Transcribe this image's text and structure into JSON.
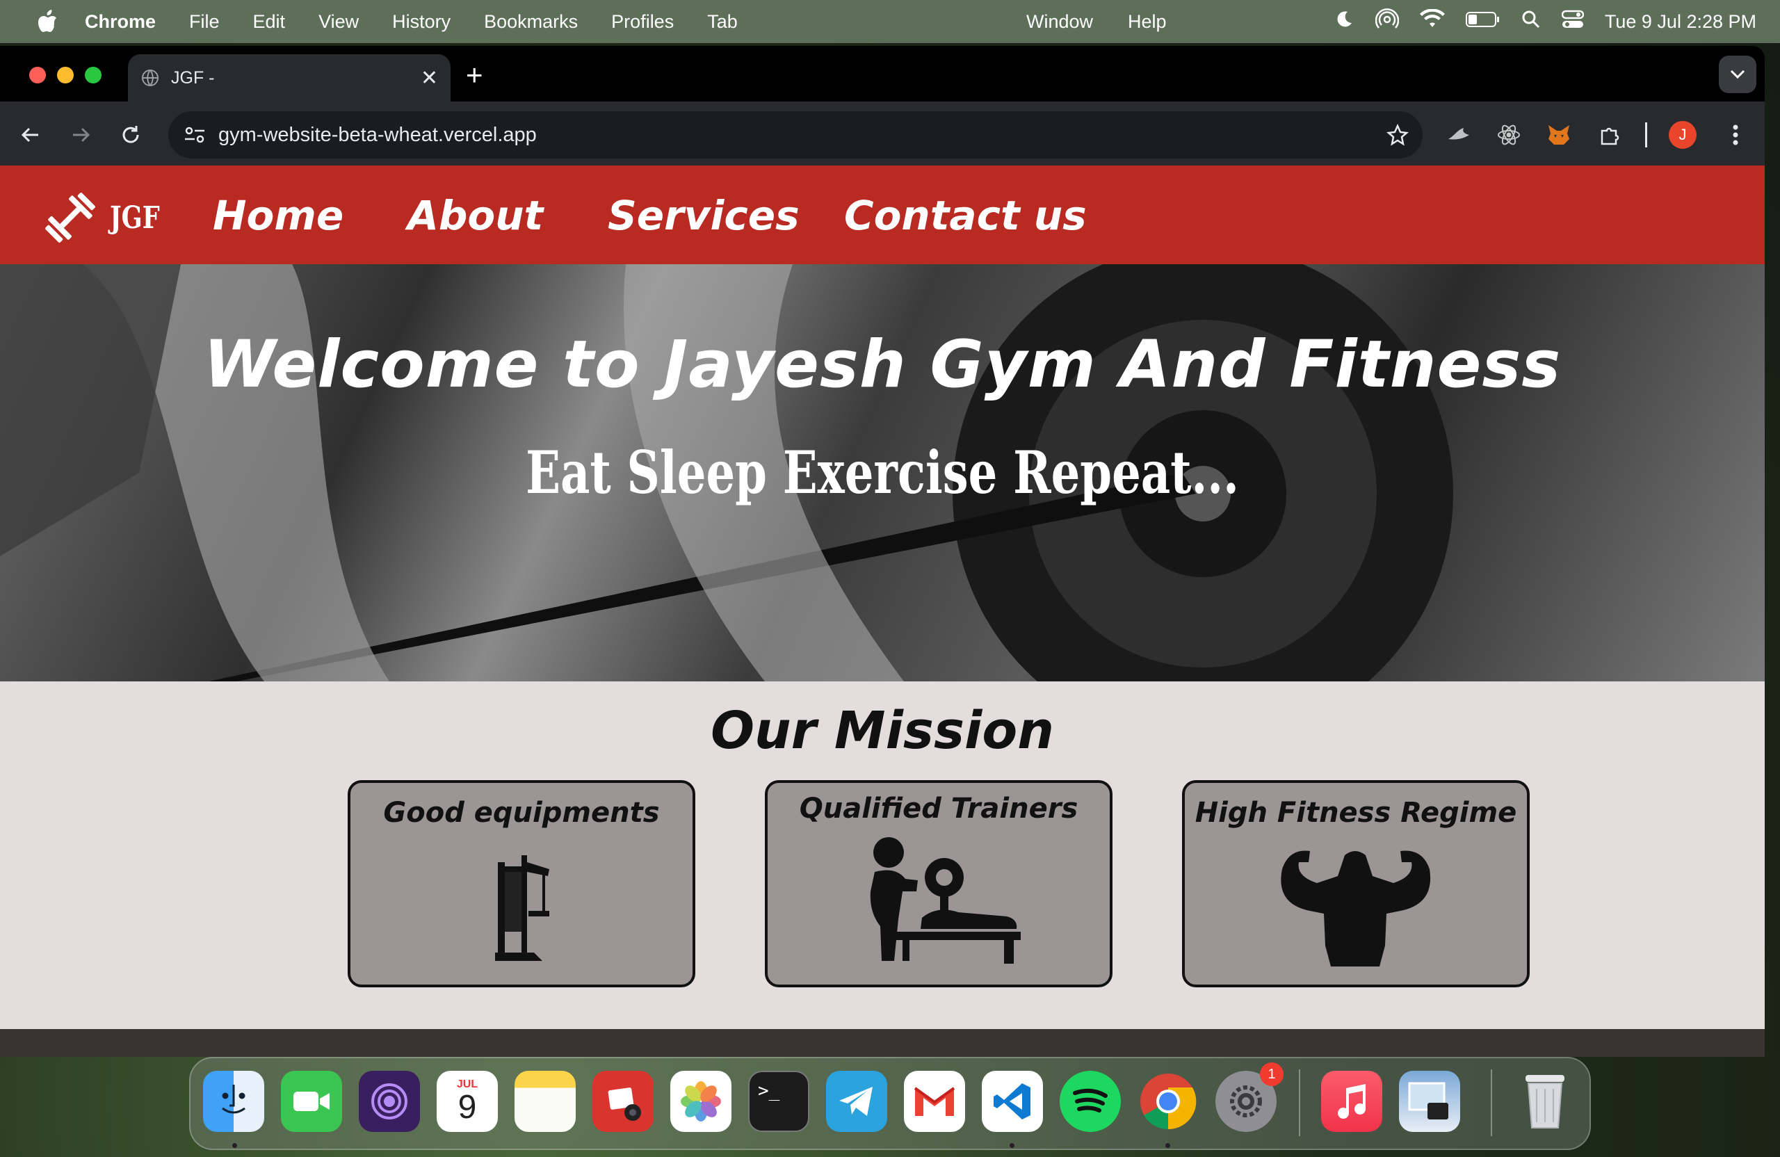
{
  "menubar": {
    "app_name": "Chrome",
    "menus": [
      "File",
      "Edit",
      "View",
      "History",
      "Bookmarks",
      "Profiles",
      "Tab",
      "Window",
      "Help"
    ],
    "clock": "Tue 9 Jul  2:28 PM"
  },
  "browser": {
    "tab_title": "JGF -",
    "url": "gym-website-beta-wheat.vercel.app",
    "profile_initial": "J"
  },
  "site": {
    "logo_text": "JGF",
    "nav": [
      "Home",
      "About",
      "Services",
      "Contact us"
    ],
    "hero_title": "Welcome to Jayesh Gym And Fitness",
    "hero_tagline": "Eat Sleep Exercise Repeat...",
    "mission_title": "Our Mission",
    "cards": [
      "Good equipments",
      "Qualified Trainers",
      "High Fitness Regime"
    ]
  },
  "dock": {
    "calendar_month": "JUL",
    "calendar_day": "9",
    "settings_badge": "1",
    "apps": [
      "finder",
      "facetime",
      "tor-browser",
      "calendar",
      "notes",
      "photo-booth",
      "photos",
      "terminal",
      "telegram",
      "gmail",
      "vscode",
      "spotify",
      "chrome",
      "system-settings",
      "music",
      "preview",
      "trash"
    ]
  },
  "colors": {
    "navbar": "#b92a23",
    "page_bg": "#e3dedd",
    "card_bg": "#9b9595"
  }
}
